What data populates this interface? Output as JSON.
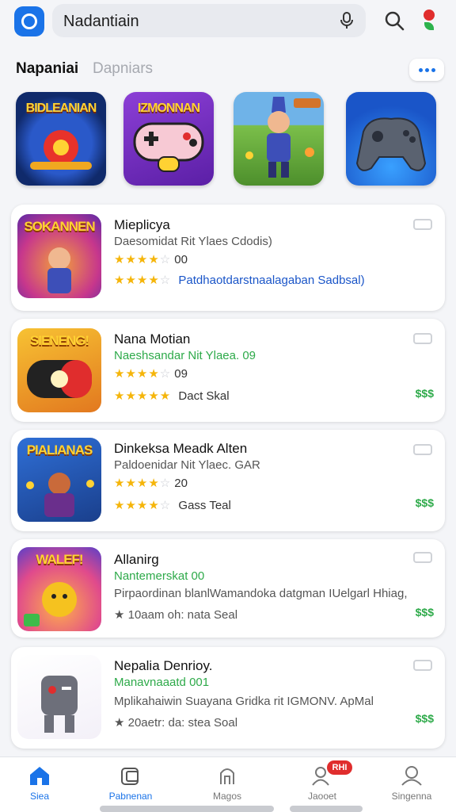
{
  "search": {
    "value": "Nadantiain"
  },
  "section": {
    "title": "Napaniai",
    "subtitle": "Dapniars"
  },
  "featured": [
    {
      "tag": "BIDLEANIAN",
      "icon": "game-art-1"
    },
    {
      "tag": "IZMONNAN",
      "icon": "gamepad-icon"
    },
    {
      "tag": "",
      "icon": "game-art-3"
    },
    {
      "tag": "",
      "icon": "controller-icon"
    }
  ],
  "apps": [
    {
      "tag": "SOKANNEN",
      "name": "Mieplicya",
      "line2": "Daesomidat Rit Ylaes Cdodis)",
      "rating": 4,
      "rating_label": "00",
      "rating2": 4,
      "line4": "Patdhaotdarstnaalagaban Sadbsal)",
      "price": ""
    },
    {
      "tag": "SIENENG!",
      "name": "Nana Motian",
      "line2": "Naeshsandar Nit Ylaea. 09",
      "rating": 4,
      "rating_label": "09",
      "rating2": 5,
      "line4": "Dact Skal",
      "price": "$$$"
    },
    {
      "tag": "PIALIANAS",
      "name": "Dinkeksa Meadk Alten",
      "line2": "Paldoenidar Nit Ylaec. GAR",
      "rating": 4,
      "rating_label": "20",
      "rating2": 4,
      "line4": "Gass Teal",
      "price": "$$$"
    },
    {
      "tag": "WALEF!",
      "name": "Allanirg",
      "line2": "Nantemerskat 00",
      "line3": "Pirpaordinan blanlWamandoka datgman IUelgarl Hhiag,",
      "line4": "★ 10aam oh: nata Seal",
      "price": "$$$"
    },
    {
      "tag": "",
      "name": "Nepalia Denrioy.",
      "line2": "Manavnaaatd 001",
      "line3": "Mplikahaiwin Suayana Gridka rit IGMONV. ApMal",
      "line4": "★ 20aetr: da: stea Soal",
      "price": "$$$"
    }
  ],
  "nav": [
    {
      "label": "Siea",
      "icon": "home-icon",
      "active": true
    },
    {
      "label": "Pabnenan",
      "icon": "apps-icon",
      "active": true
    },
    {
      "label": "Magos",
      "icon": "bag-icon"
    },
    {
      "label": "Jaooet",
      "icon": "account-alert-icon",
      "badge": "RHI"
    },
    {
      "label": "Singenna",
      "icon": "profile-icon"
    }
  ],
  "colors": {
    "accent": "#1a73e8",
    "price": "#2eaa4a",
    "star": "#f5b50a",
    "badge": "#e02d2d"
  }
}
